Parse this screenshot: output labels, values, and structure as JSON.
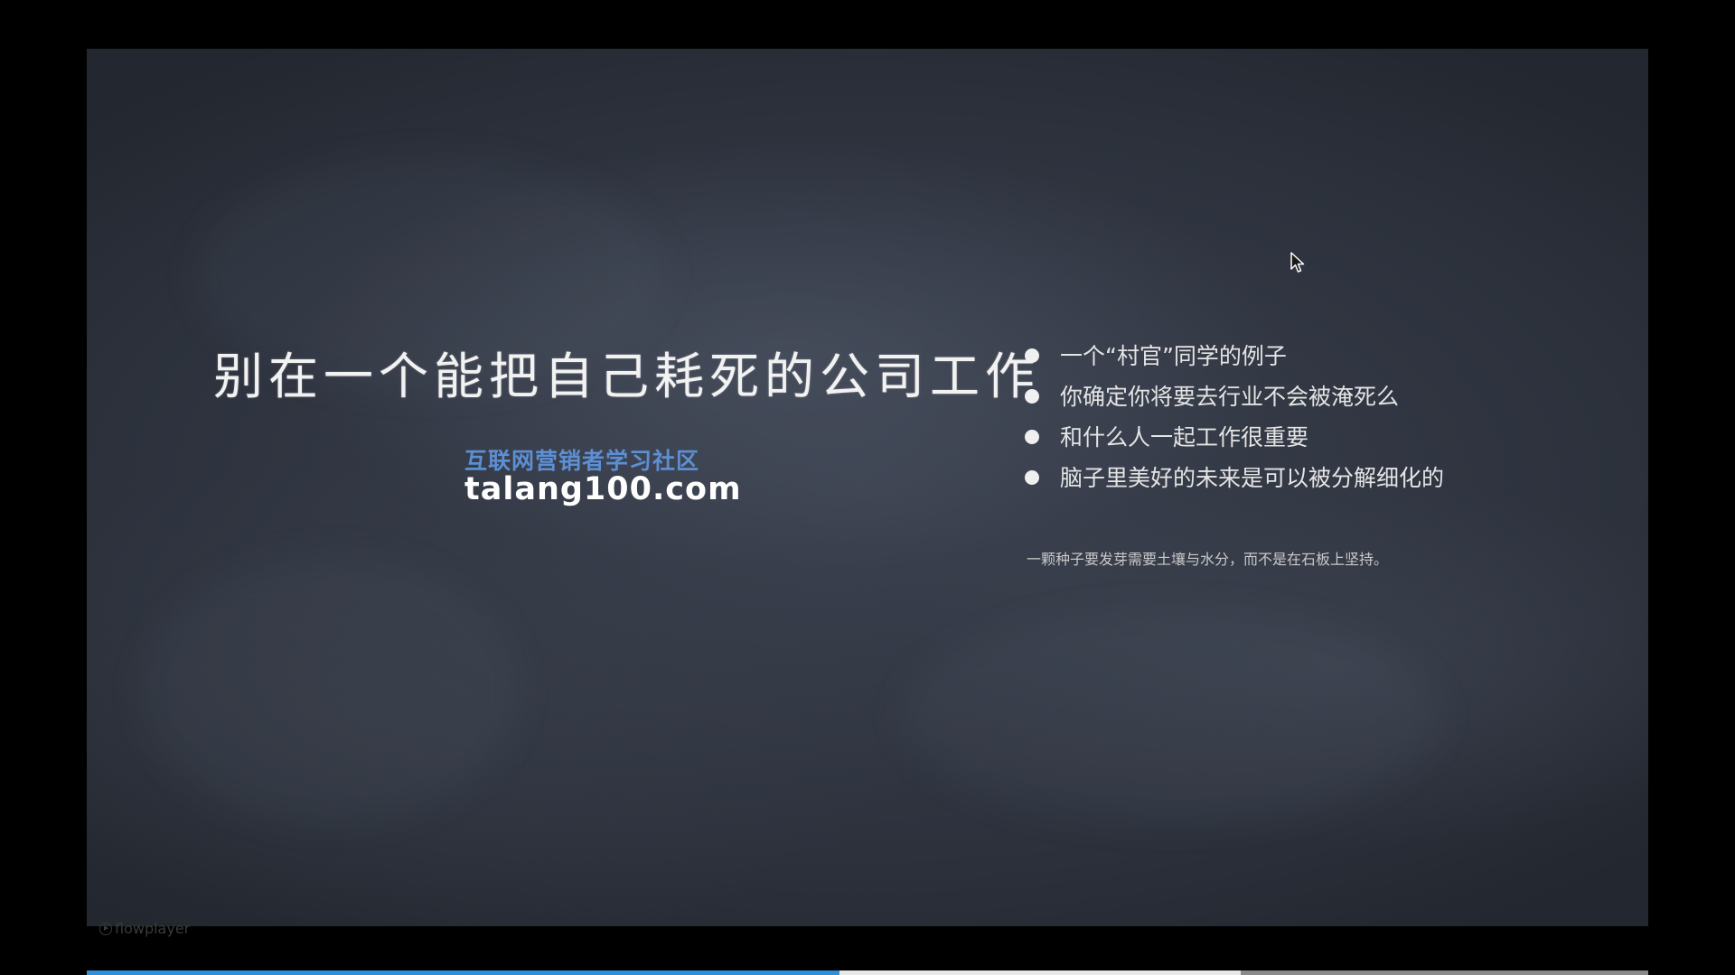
{
  "slide": {
    "title": "别在一个能把自己耗死的公司工作",
    "brand_cn": "互联网营销者学习社区",
    "brand_url": "talang100.com",
    "bullets": [
      "一个“村官”同学的例子",
      "你确定你将要去行业不会被淹死么",
      "和什么人一起工作很重要",
      "脑子里美好的未来是可以被分解细化的"
    ],
    "note": "一颗种子要发芽需要土壤与水分，而不是在石板上坚持。"
  },
  "player": {
    "logo_text": "flowplayer",
    "progress_fraction": 0.482,
    "buffer_fraction": 0.739,
    "cursor_icon": "mouse-pointer-icon",
    "colors": {
      "progress": "#2f8fd8",
      "brand_cn": "#5d8fd3",
      "background": "#000000"
    }
  }
}
